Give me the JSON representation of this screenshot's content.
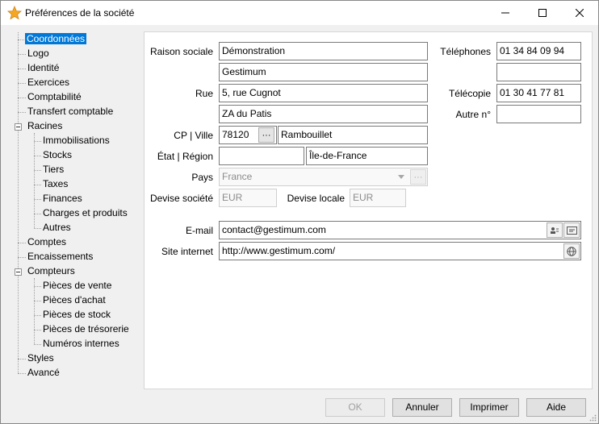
{
  "window": {
    "title": "Préférences de la société"
  },
  "tree": {
    "items": [
      "Coordonnées",
      "Logo",
      "Identité",
      "Exercices",
      "Comptabilité",
      "Transfert comptable",
      "Racines",
      "Immobilisations",
      "Stocks",
      "Tiers",
      "Taxes",
      "Finances",
      "Charges et produits",
      "Autres",
      "Comptes",
      "Encaissements",
      "Compteurs",
      "Pièces de vente",
      "Pièces d'achat",
      "Pièces de stock",
      "Pièces de trésorerie",
      "Numéros internes",
      "Styles",
      "Avancé"
    ]
  },
  "form": {
    "raison_sociale_label": "Raison sociale",
    "raison_sociale_1": "Démonstration",
    "raison_sociale_2": "Gestimum",
    "rue_label": "Rue",
    "rue_1": "5, rue Cugnot",
    "rue_2": "ZA du Patis",
    "cp_ville_label": "CP | Ville",
    "cp": "78120",
    "ville": "Rambouillet",
    "etat_region_label": "État | Région",
    "etat": "",
    "region": "Île-de-France",
    "pays_label": "Pays",
    "pays": "France",
    "devise_societe_label": "Devise société",
    "devise_societe": "EUR",
    "devise_locale_label": "Devise locale",
    "devise_locale": "EUR",
    "telephones_label": "Téléphones",
    "telephone_1": "01 34 84 09 94",
    "telephone_2": "",
    "telecopie_label": "Télécopie",
    "telecopie": "01 30 41 77 81",
    "autre_label": "Autre n°",
    "autre": "",
    "email_label": "E-mail",
    "email": "contact@gestimum.com",
    "site_label": "Site internet",
    "site": "http://www.gestimum.com/",
    "ellipsis": "···"
  },
  "buttons": {
    "ok": "OK",
    "annuler": "Annuler",
    "imprimer": "Imprimer",
    "aide": "Aide"
  },
  "colors": {
    "selection": "#0078d7",
    "star": "#f5a623"
  }
}
